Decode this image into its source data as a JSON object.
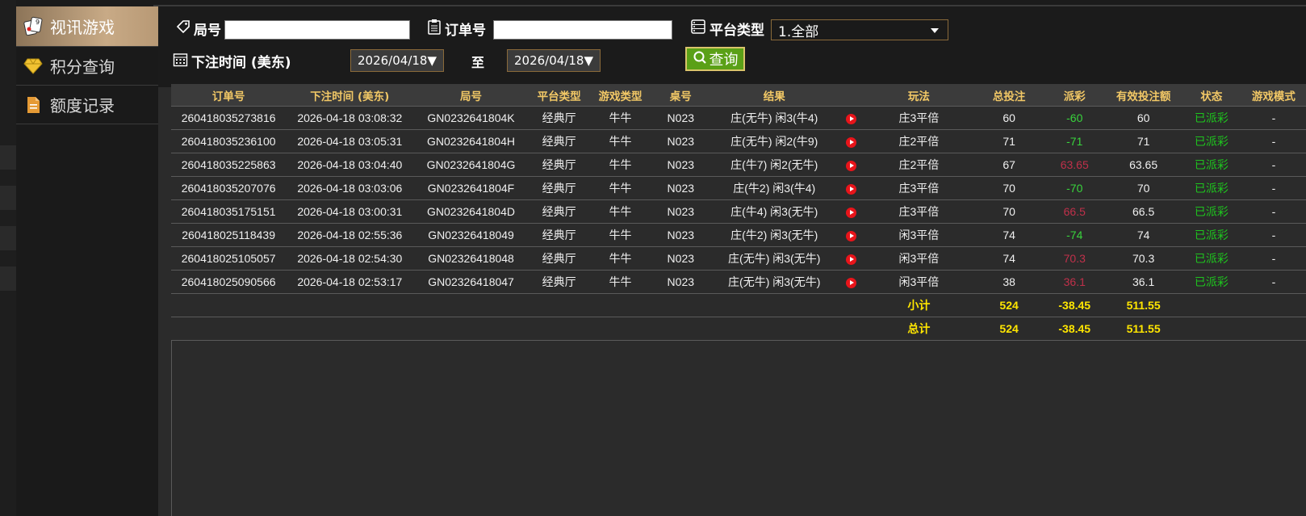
{
  "sidebar": {
    "items": [
      {
        "label": "视讯游戏",
        "icon": "cards-icon",
        "active": true
      },
      {
        "label": "积分查询",
        "icon": "diamond-icon",
        "active": false
      },
      {
        "label": "额度记录",
        "icon": "document-icon",
        "active": false
      }
    ]
  },
  "filters": {
    "round_label": "局号",
    "round_value": "",
    "order_label": "订单号",
    "order_value": "",
    "platform_label": "平台类型",
    "platform_selected": "1.全部",
    "time_label": "下注时间 (美东)",
    "date_from": "2026/04/18▼",
    "to_label": "至",
    "date_to": "2026/04/18▼",
    "query_label": "查询"
  },
  "table": {
    "headers": [
      "订单号",
      "下注时间 (美东)",
      "局号",
      "平台类型",
      "游戏类型",
      "桌号",
      "结果",
      "",
      "玩法",
      "总投注",
      "派彩",
      "有效投注额",
      "状态",
      "游戏模式"
    ],
    "rows": [
      {
        "order": "260418035273816",
        "time": "2026-04-18 03:08:32",
        "round": "GN0232641804K",
        "platform": "经典厅",
        "game": "牛牛",
        "table": "N023",
        "result": "庄(无牛) 闲3(牛4)",
        "play": "庄3平倍",
        "bet": "60",
        "payout": "-60",
        "valid": "60",
        "status": "已派彩",
        "mode": "-"
      },
      {
        "order": "260418035236100",
        "time": "2026-04-18 03:05:31",
        "round": "GN0232641804H",
        "platform": "经典厅",
        "game": "牛牛",
        "table": "N023",
        "result": "庄(无牛) 闲2(牛9)",
        "play": "庄2平倍",
        "bet": "71",
        "payout": "-71",
        "valid": "71",
        "status": "已派彩",
        "mode": "-"
      },
      {
        "order": "260418035225863",
        "time": "2026-04-18 03:04:40",
        "round": "GN0232641804G",
        "platform": "经典厅",
        "game": "牛牛",
        "table": "N023",
        "result": "庄(牛7) 闲2(无牛)",
        "play": "庄2平倍",
        "bet": "67",
        "payout": "63.65",
        "valid": "63.65",
        "status": "已派彩",
        "mode": "-"
      },
      {
        "order": "260418035207076",
        "time": "2026-04-18 03:03:06",
        "round": "GN0232641804F",
        "platform": "经典厅",
        "game": "牛牛",
        "table": "N023",
        "result": "庄(牛2) 闲3(牛4)",
        "play": "庄3平倍",
        "bet": "70",
        "payout": "-70",
        "valid": "70",
        "status": "已派彩",
        "mode": "-"
      },
      {
        "order": "260418035175151",
        "time": "2026-04-18 03:00:31",
        "round": "GN0232641804D",
        "platform": "经典厅",
        "game": "牛牛",
        "table": "N023",
        "result": "庄(牛4) 闲3(无牛)",
        "play": "庄3平倍",
        "bet": "70",
        "payout": "66.5",
        "valid": "66.5",
        "status": "已派彩",
        "mode": "-"
      },
      {
        "order": "260418025118439",
        "time": "2026-04-18 02:55:36",
        "round": "GN02326418049",
        "platform": "经典厅",
        "game": "牛牛",
        "table": "N023",
        "result": "庄(牛2) 闲3(无牛)",
        "play": "闲3平倍",
        "bet": "74",
        "payout": "-74",
        "valid": "74",
        "status": "已派彩",
        "mode": "-"
      },
      {
        "order": "260418025105057",
        "time": "2026-04-18 02:54:30",
        "round": "GN02326418048",
        "platform": "经典厅",
        "game": "牛牛",
        "table": "N023",
        "result": "庄(无牛) 闲3(无牛)",
        "play": "闲3平倍",
        "bet": "74",
        "payout": "70.3",
        "valid": "70.3",
        "status": "已派彩",
        "mode": "-"
      },
      {
        "order": "260418025090566",
        "time": "2026-04-18 02:53:17",
        "round": "GN02326418047",
        "platform": "经典厅",
        "game": "牛牛",
        "table": "N023",
        "result": "庄(无牛) 闲3(无牛)",
        "play": "闲3平倍",
        "bet": "38",
        "payout": "36.1",
        "valid": "36.1",
        "status": "已派彩",
        "mode": "-"
      }
    ],
    "subtotal": {
      "label": "小计",
      "bet": "524",
      "payout": "-38.45",
      "valid": "511.55"
    },
    "total": {
      "label": "总计",
      "bet": "524",
      "payout": "-38.45",
      "valid": "511.55"
    }
  },
  "colors": {
    "header_text": "#f2c866",
    "negative": "#38d43c",
    "positive": "#c0304a",
    "status": "#1ec41e",
    "total_text": "#ffe600",
    "query_button": "#5aa017"
  }
}
